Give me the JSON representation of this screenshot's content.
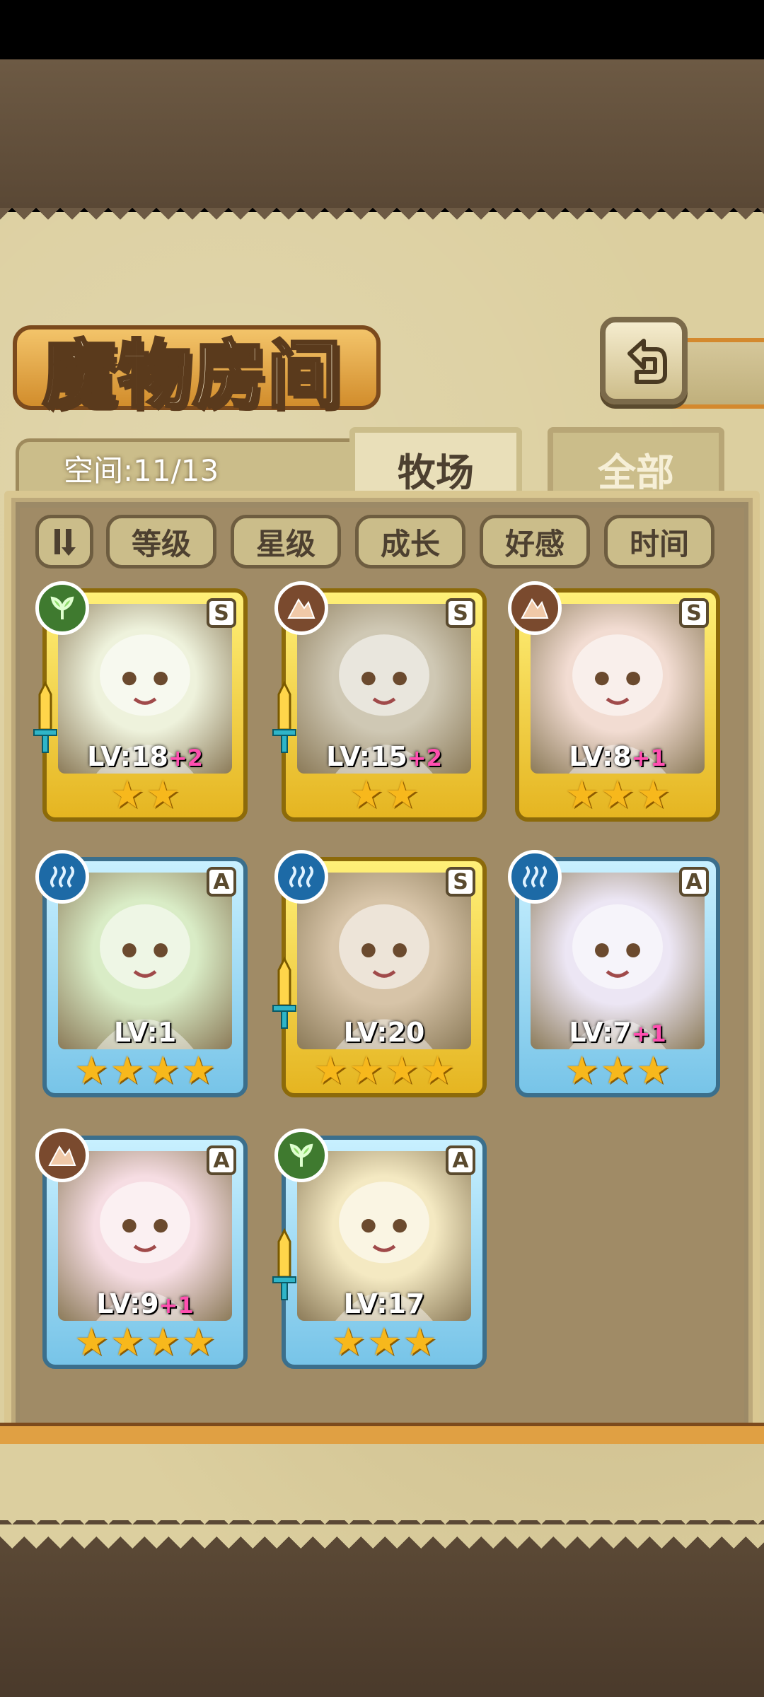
{
  "page": {
    "title": "魔物房间",
    "space_label": "空间:11/13"
  },
  "tabs": [
    {
      "label": "牧场",
      "active": true
    },
    {
      "label": "全部",
      "active": false
    }
  ],
  "sort_buttons": [
    "等级",
    "星级",
    "成长",
    "好感",
    "时间"
  ],
  "icons": {
    "back": "back-arrow-icon",
    "sort_order": "sort-order-icon"
  },
  "colors": {
    "grass": "#3f7a2f",
    "rock": "#7a4a2e",
    "water": "#1d6aa6",
    "frame_S": "#e5b521",
    "frame_A": "#77c4e8",
    "star": "#f7b81c",
    "plus": "#ff4fb0"
  },
  "monsters": [
    {
      "level": "LV:18",
      "plus": "+2",
      "rank": "S",
      "element": "grass",
      "stars": 2,
      "weapon": true,
      "tint": "#eef2dc"
    },
    {
      "level": "LV:15",
      "plus": "+2",
      "rank": "S",
      "element": "rock",
      "stars": 2,
      "weapon": true,
      "tint": "#cfc8b4"
    },
    {
      "level": "LV:8",
      "plus": "+1",
      "rank": "S",
      "element": "rock",
      "stars": 3,
      "weapon": false,
      "tint": "#f2dcd2"
    },
    {
      "level": "LV:1",
      "plus": "",
      "rank": "A",
      "element": "water",
      "stars": 4,
      "weapon": false,
      "tint": "#d9ecc6"
    },
    {
      "level": "LV:20",
      "plus": "",
      "rank": "S",
      "element": "water",
      "stars": 4,
      "weapon": true,
      "tint": "#d7c4a8"
    },
    {
      "level": "LV:7",
      "plus": "+1",
      "rank": "A",
      "element": "water",
      "stars": 3,
      "weapon": false,
      "tint": "#ece6f4"
    },
    {
      "level": "LV:9",
      "plus": "+1",
      "rank": "A",
      "element": "rock",
      "stars": 4,
      "weapon": false,
      "tint": "#f6dde3"
    },
    {
      "level": "LV:17",
      "plus": "",
      "rank": "A",
      "element": "grass",
      "stars": 3,
      "weapon": true,
      "tint": "#f4e9c2"
    }
  ]
}
